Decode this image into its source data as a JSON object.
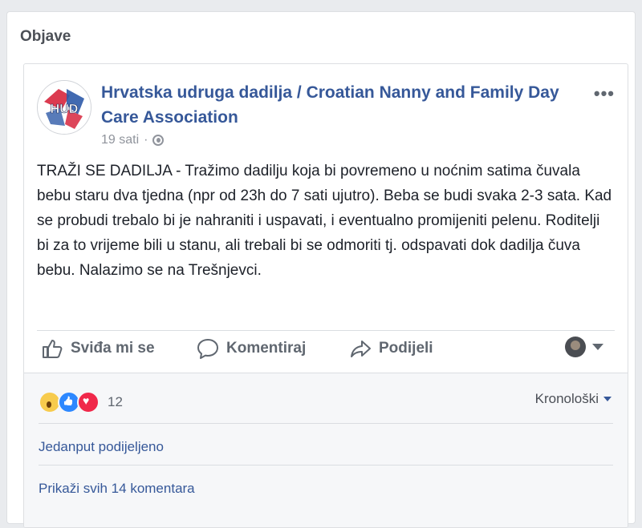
{
  "section": {
    "title": "Objave"
  },
  "post": {
    "page_name": "Hrvatska udruga dadilja / Croatian Nanny and Family Day Care Association",
    "time": "19 sati",
    "separator": "·",
    "more_label": "•••",
    "text": "TRAŽI SE DADILJA - Tražimo dadilju koja bi povremeno u noćnim satima čuvala bebu staru dva tjedna (npr od 23h do 7 sati ujutro). Beba se budi svaka 2-3 sata. Kad se probudi trebalo bi je nahraniti i uspavati, i eventualno promijeniti pelenu. Roditelji bi za to vrijeme bili u stanu, ali trebali bi se odmoriti tj. odspavati dok dadilja čuva bebu. Nalazimo se na Trešnjevci.",
    "avatar_text": "HUD"
  },
  "actions": {
    "like": "Sviđa mi se",
    "comment": "Komentiraj",
    "share": "Podijeli"
  },
  "footer": {
    "reaction_count": "12",
    "sort_label": "Kronološki",
    "shares_label": "Jedanput podijeljeno",
    "comments_label": "Prikaži svih 14 komentara"
  },
  "colors": {
    "link": "#365899",
    "muted": "#606770",
    "background": "#e9ebee"
  },
  "icons": {
    "more": "more-options-icon",
    "globe": "globe-icon",
    "like": "thumbs-up-icon",
    "comment": "speech-bubble-icon",
    "share": "share-arrow-icon"
  }
}
